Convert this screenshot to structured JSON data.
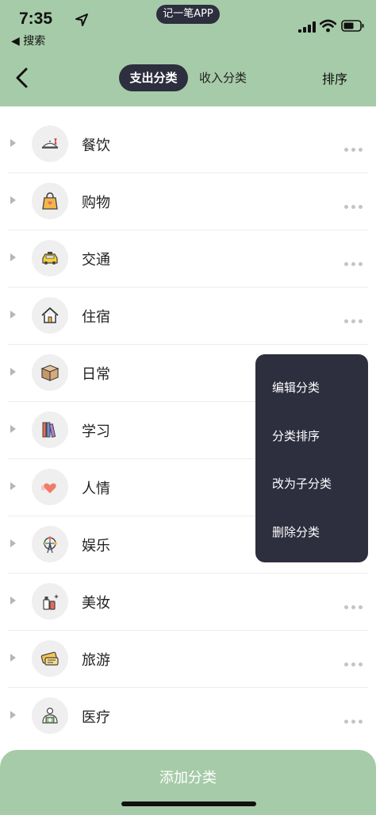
{
  "status": {
    "time": "7:35",
    "back_app": "◀ 搜索",
    "app_pill": "记一笔APP"
  },
  "nav": {
    "tabs": [
      {
        "label": "支出分类",
        "active": true
      },
      {
        "label": "收入分类",
        "active": false
      }
    ],
    "sort_label": "排序"
  },
  "categories": [
    {
      "label": "餐饮",
      "icon": "dining-icon"
    },
    {
      "label": "购物",
      "icon": "shopping-bag-icon"
    },
    {
      "label": "交通",
      "icon": "taxi-icon"
    },
    {
      "label": "住宿",
      "icon": "house-icon"
    },
    {
      "label": "日常",
      "icon": "box-icon"
    },
    {
      "label": "学习",
      "icon": "books-icon"
    },
    {
      "label": "人情",
      "icon": "heart-icon"
    },
    {
      "label": "娱乐",
      "icon": "ferris-wheel-icon"
    },
    {
      "label": "美妆",
      "icon": "cosmetics-icon"
    },
    {
      "label": "旅游",
      "icon": "ticket-icon"
    },
    {
      "label": "医疗",
      "icon": "medical-icon"
    }
  ],
  "context_menu": {
    "items": [
      "编辑分类",
      "分类排序",
      "改为子分类",
      "删除分类"
    ]
  },
  "footer": {
    "add_label": "添加分类"
  },
  "colors": {
    "header_bg": "#a6cba8",
    "dark": "#2d2e3e"
  }
}
